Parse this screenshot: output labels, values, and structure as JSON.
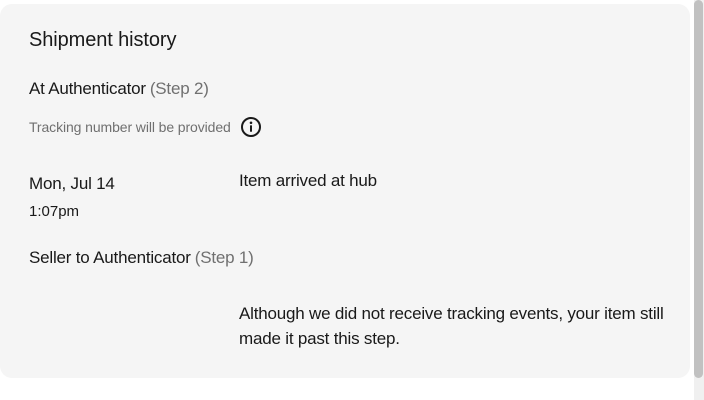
{
  "shipment_history": {
    "title": "Shipment history",
    "steps": [
      {
        "label": "At Authenticator",
        "step_tag": "(Step 2)",
        "tracking_note": "Tracking number will be provided",
        "info_icon": "info-circle-icon",
        "events": [
          {
            "date": "Mon, Jul 14",
            "time": "1:07pm",
            "description": "Item arrived at hub"
          }
        ]
      },
      {
        "label": "Seller to Authenticator",
        "step_tag": "(Step 1)",
        "description": "Although we did not receive tracking events, your item still made it past this step."
      }
    ]
  },
  "colors": {
    "card_background": "#f5f5f5",
    "text_primary": "#191919",
    "text_secondary": "#707070"
  }
}
